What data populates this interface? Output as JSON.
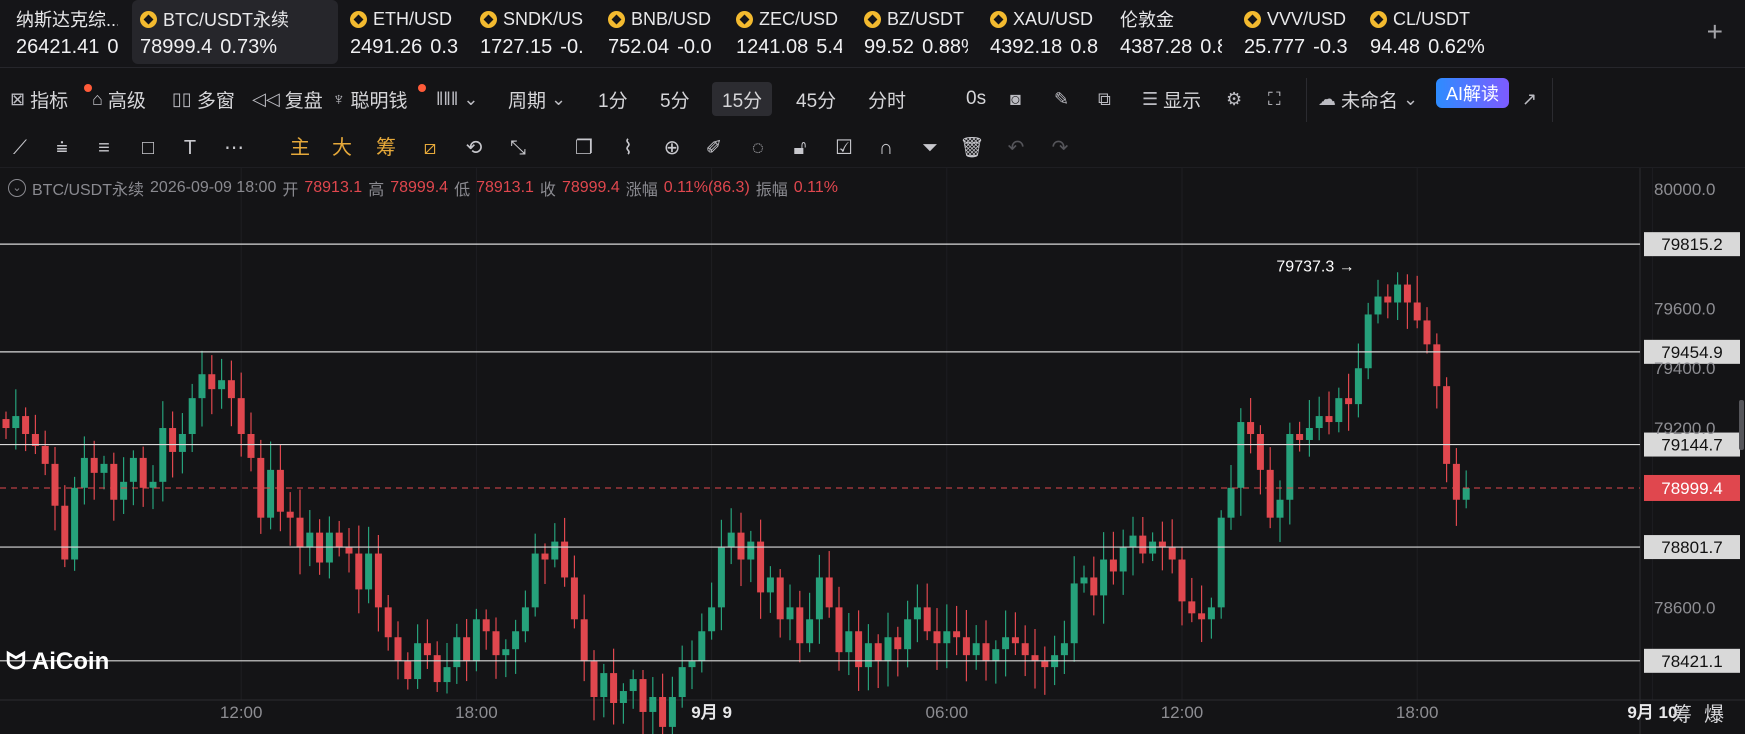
{
  "tickers": [
    {
      "name": "纳斯达克综...",
      "price": "26421.41",
      "change": "0.0",
      "down": false,
      "coin": false
    },
    {
      "name": "BTC/USDT永续",
      "price": "78999.4",
      "change": "0.73%",
      "down": true,
      "coin": true,
      "active": true
    },
    {
      "name": "ETH/USD",
      "price": "2491.26",
      "change": "0.3",
      "down": false,
      "coin": true
    },
    {
      "name": "SNDK/US",
      "price": "1727.15",
      "change": "-0.",
      "down": true,
      "coin": true
    },
    {
      "name": "BNB/USD",
      "price": "752.04",
      "change": "-0.0",
      "down": false,
      "coin": true
    },
    {
      "name": "ZEC/USD",
      "price": "1241.08",
      "change": "5.4",
      "down": false,
      "coin": true
    },
    {
      "name": "BZ/USDT",
      "price": "99.52",
      "change": "0.88%",
      "down": true,
      "coin": true
    },
    {
      "name": "XAU/USD",
      "price": "4392.18",
      "change": "0.8",
      "down": false,
      "coin": true
    },
    {
      "name": "伦敦金",
      "price": "4387.28",
      "change": "0.8",
      "down": true,
      "coin": false
    },
    {
      "name": "VVV/USD",
      "price": "25.777",
      "change": "-0.3",
      "down": false,
      "coin": true
    },
    {
      "name": "CL/USDT",
      "price": "94.48",
      "change": "0.62%",
      "down": false,
      "coin": true
    }
  ],
  "add_tab": "+",
  "toolbar": {
    "indicator": "指标",
    "advanced": "高级",
    "multi_window": "多窗",
    "replay": "复盘",
    "smart_money": "聪明钱",
    "period": "周期",
    "periods": [
      "1分",
      "5分",
      "15分",
      "45分",
      "分时"
    ],
    "active_period": "15分",
    "countdown": "0s",
    "display": "显示",
    "layout_name": "未命名",
    "ai_button": "AI解读"
  },
  "drawbar": {
    "main": "主",
    "big": "大",
    "chip": "筹"
  },
  "ohlc": {
    "symbol": "BTC/USDT永续",
    "datetime": "2026-09-09 18:00",
    "open_label": "开",
    "open": "78913.1",
    "high_label": "高",
    "high": "78999.4",
    "low_label": "低",
    "low": "78913.1",
    "close_label": "收",
    "close": "78999.4",
    "change_label": "涨幅",
    "change": "0.11%(86.3)",
    "amp_label": "振幅",
    "amp": "0.11%"
  },
  "watermark": "AiCoin",
  "bottom_right": "筹爆",
  "colors": {
    "up": "#26a17b",
    "down": "#e0474e",
    "bg": "#141416",
    "grid": "#1e1e22",
    "hline": "#d9d9d9"
  },
  "chart_data": {
    "type": "candlestick",
    "y_ticks": [
      80000,
      79800,
      79600,
      79400,
      79200,
      79000,
      78800,
      78600,
      78400
    ],
    "y_tick_labels": [
      "80000.0",
      "79600.0",
      "79400.0",
      "79200.0",
      "78600.0"
    ],
    "x_tick_labels": [
      {
        "label": "12:00",
        "index": 24,
        "bold": false
      },
      {
        "label": "18:00",
        "index": 48,
        "bold": false
      },
      {
        "label": "9月 9",
        "index": 72,
        "bold": true
      },
      {
        "label": "06:00",
        "index": 96,
        "bold": false
      },
      {
        "label": "12:00",
        "index": 120,
        "bold": false
      },
      {
        "label": "18:00",
        "index": 144,
        "bold": false
      },
      {
        "label": "9月 10",
        "index": 168,
        "bold": true
      }
    ],
    "horizontal_lines": [
      79815.2,
      79454.9,
      79144.7,
      78801.7,
      78421.1
    ],
    "horizontal_line_labels": [
      "79815.2",
      "79454.9",
      "79144.7",
      "78801.7",
      "78421.1"
    ],
    "last_price": 78999.4,
    "last_price_label": "78999.4",
    "max_marker": {
      "value": 79737.3,
      "label": "79737.3 →",
      "index": 138
    },
    "candles_close": [
      79200,
      79240,
      79180,
      79140,
      79080,
      78940,
      78760,
      79000,
      79100,
      79050,
      79080,
      78960,
      79020,
      79100,
      79000,
      79020,
      79200,
      79120,
      79180,
      79300,
      79380,
      79330,
      79360,
      79300,
      79180,
      79100,
      78900,
      79060,
      78920,
      78900,
      78800,
      78850,
      78750,
      78850,
      78800,
      78780,
      78660,
      78780,
      78600,
      78500,
      78420,
      78360,
      78480,
      78440,
      78350,
      78400,
      78500,
      78420,
      78560,
      78520,
      78440,
      78460,
      78520,
      78600,
      78780,
      78760,
      78820,
      78700,
      78560,
      78420,
      78300,
      78380,
      78280,
      78320,
      78360,
      78250,
      78300,
      78200,
      78300,
      78400,
      78420,
      78520,
      78600,
      78800,
      78850,
      78760,
      78820,
      78650,
      78700,
      78560,
      78600,
      78480,
      78560,
      78700,
      78600,
      78450,
      78520,
      78400,
      78480,
      78420,
      78500,
      78460,
      78560,
      78600,
      78520,
      78480,
      78520,
      78500,
      78440,
      78480,
      78420,
      78460,
      78500,
      78480,
      78440,
      78420,
      78400,
      78440,
      78480,
      78680,
      78700,
      78640,
      78760,
      78720,
      78800,
      78840,
      78780,
      78820,
      78800,
      78760,
      78620,
      78580,
      78560,
      78600,
      78900,
      79000,
      79220,
      79180,
      79060,
      78900,
      78960,
      79180,
      79160,
      79200,
      79240,
      79220,
      79300,
      79280,
      79400,
      79580,
      79640,
      79620,
      79680,
      79620,
      79560,
      79480,
      79340,
      79080,
      78960,
      78999.4
    ]
  }
}
